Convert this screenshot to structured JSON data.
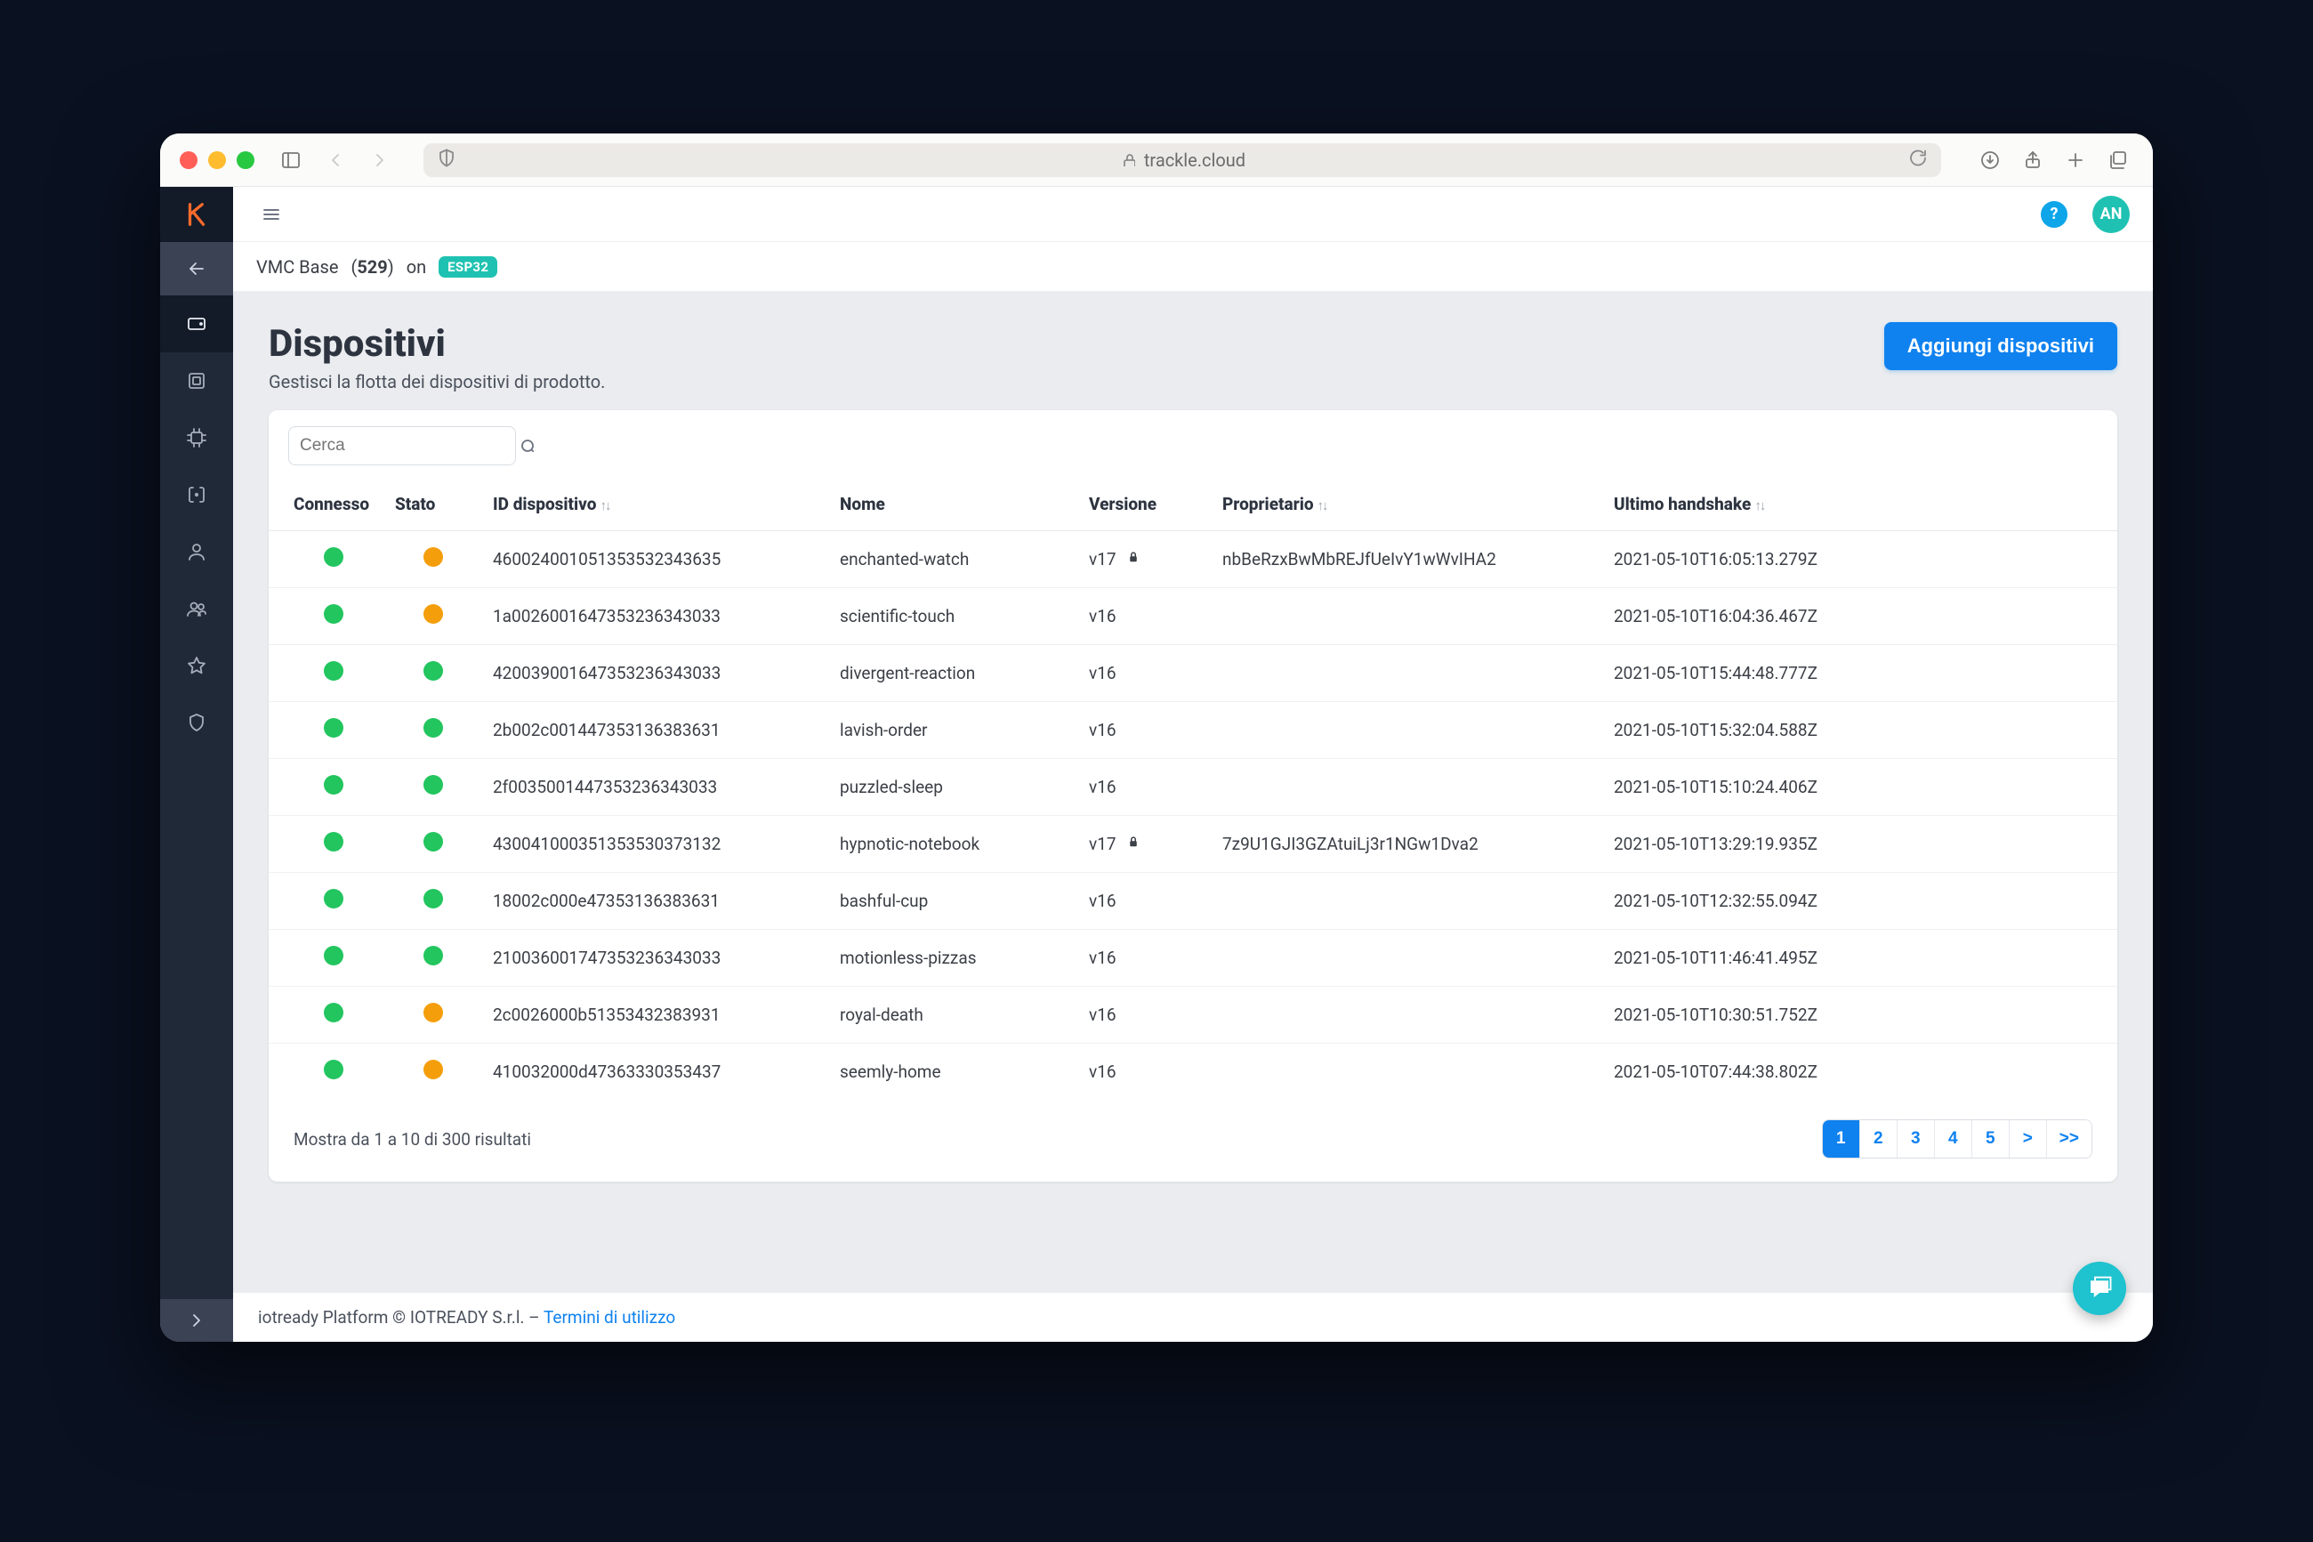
{
  "browser": {
    "url": "trackle.cloud"
  },
  "topbar": {
    "help": "?",
    "avatar": "AN"
  },
  "breadcrumb": {
    "product": "VMC Base",
    "count": "529",
    "on": "on",
    "chip": "ESP32"
  },
  "page": {
    "title": "Dispositivi",
    "subtitle": "Gestisci la flotta dei dispositivi di prodotto.",
    "add_button": "Aggiungi dispositivi"
  },
  "search": {
    "placeholder": "Cerca"
  },
  "table": {
    "headers": {
      "connected": "Connesso",
      "state": "Stato",
      "device_id": "ID dispositivo",
      "name": "Nome",
      "version": "Versione",
      "owner": "Proprietario",
      "handshake": "Ultimo handshake"
    },
    "rows": [
      {
        "conn": "green",
        "state": "orange",
        "id": "460024001051353532343635",
        "name": "enchanted-watch",
        "version": "v17",
        "lock": true,
        "owner": "nbBeRzxBwMbREJfUeIvY1wWvIHA2",
        "handshake": "2021-05-10T16:05:13.279Z"
      },
      {
        "conn": "green",
        "state": "orange",
        "id": "1a0026001647353236343033",
        "name": "scientific-touch",
        "version": "v16",
        "lock": false,
        "owner": "",
        "handshake": "2021-05-10T16:04:36.467Z"
      },
      {
        "conn": "green",
        "state": "green",
        "id": "420039001647353236343033",
        "name": "divergent-reaction",
        "version": "v16",
        "lock": false,
        "owner": "",
        "handshake": "2021-05-10T15:44:48.777Z"
      },
      {
        "conn": "green",
        "state": "green",
        "id": "2b002c001447353136383631",
        "name": "lavish-order",
        "version": "v16",
        "lock": false,
        "owner": "",
        "handshake": "2021-05-10T15:32:04.588Z"
      },
      {
        "conn": "green",
        "state": "green",
        "id": "2f0035001447353236343033",
        "name": "puzzled-sleep",
        "version": "v16",
        "lock": false,
        "owner": "",
        "handshake": "2021-05-10T15:10:24.406Z"
      },
      {
        "conn": "green",
        "state": "green",
        "id": "430041000351353530373132",
        "name": "hypnotic-notebook",
        "version": "v17",
        "lock": true,
        "owner": "7z9U1GJI3GZAtuiLj3r1NGw1Dva2",
        "handshake": "2021-05-10T13:29:19.935Z"
      },
      {
        "conn": "green",
        "state": "green",
        "id": "18002c000e47353136383631",
        "name": "bashful-cup",
        "version": "v16",
        "lock": false,
        "owner": "",
        "handshake": "2021-05-10T12:32:55.094Z"
      },
      {
        "conn": "green",
        "state": "green",
        "id": "210036001747353236343033",
        "name": "motionless-pizzas",
        "version": "v16",
        "lock": false,
        "owner": "",
        "handshake": "2021-05-10T11:46:41.495Z"
      },
      {
        "conn": "green",
        "state": "orange",
        "id": "2c0026000b51353432383931",
        "name": "royal-death",
        "version": "v16",
        "lock": false,
        "owner": "",
        "handshake": "2021-05-10T10:30:51.752Z"
      },
      {
        "conn": "green",
        "state": "orange",
        "id": "410032000d47363330353437",
        "name": "seemly-home",
        "version": "v16",
        "lock": false,
        "owner": "",
        "handshake": "2021-05-10T07:44:38.802Z"
      }
    ]
  },
  "footer": {
    "summary": "Mostra da 1 a 10 di 300 risultati",
    "pages": [
      "1",
      "2",
      "3",
      "4",
      "5",
      ">",
      ">>"
    ],
    "active_page": 0
  },
  "app_footer": {
    "text": "iotready Platform © IOTREADY S.r.l. – ",
    "terms": "Termini di utilizzo"
  },
  "sidebar": {
    "logo_text": "K"
  }
}
